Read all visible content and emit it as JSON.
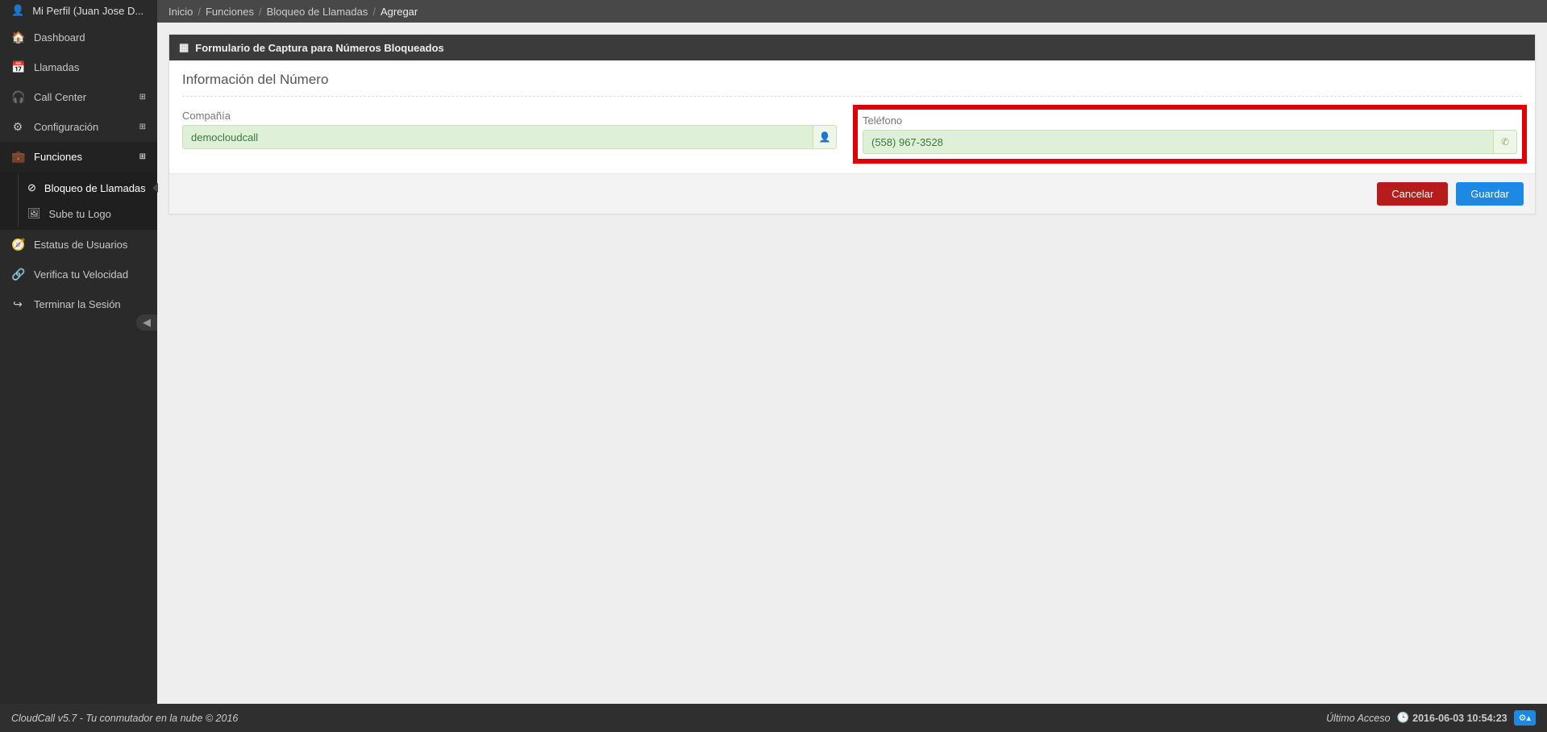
{
  "profile": {
    "label": "Mi Perfil (Juan Jose D..."
  },
  "sidebar": {
    "items": [
      {
        "icon": "🏠",
        "label": "Dashboard",
        "expandable": false
      },
      {
        "icon": "📅",
        "label": "Llamadas",
        "expandable": false
      },
      {
        "icon": "🎧",
        "label": "Call Center",
        "expandable": true
      },
      {
        "icon": "⚙",
        "label": "Configuración",
        "expandable": true
      },
      {
        "icon": "💼",
        "label": "Funciones",
        "expandable": true,
        "open": true
      },
      {
        "icon": "🧭",
        "label": "Estatus de Usuarios",
        "expandable": false
      },
      {
        "icon": "🔗",
        "label": "Verifica tu Velocidad",
        "expandable": false
      },
      {
        "icon": "↪",
        "label": "Terminar la Sesión",
        "expandable": false
      }
    ],
    "sub": [
      {
        "icon": "⊘",
        "label": "Bloqueo de Llamadas",
        "active": true
      },
      {
        "icon": "🖼",
        "label": "Sube tu Logo",
        "active": false
      }
    ]
  },
  "breadcrumb": {
    "items": [
      "Inicio",
      "Funciones",
      "Bloqueo de Llamadas"
    ],
    "current": "Agregar"
  },
  "panel": {
    "header_icon": "▦",
    "title": "Formulario de Captura para Números Bloqueados",
    "section_title": "Información del Número"
  },
  "form": {
    "company": {
      "label": "Compañía",
      "value": "democloudcall",
      "addon_icon": "👤"
    },
    "phone": {
      "label": "Teléfono",
      "value": "(558) 967-3528",
      "addon_icon": "✆"
    }
  },
  "actions": {
    "cancel": "Cancelar",
    "save": "Guardar"
  },
  "footer": {
    "left": "CloudCall v5.7 - Tu conmutador en la nube © 2016",
    "last_access_label": "Último Acceso",
    "last_access_value": "2016-06-03 10:54:23",
    "badge_icon": "⚙▴"
  }
}
